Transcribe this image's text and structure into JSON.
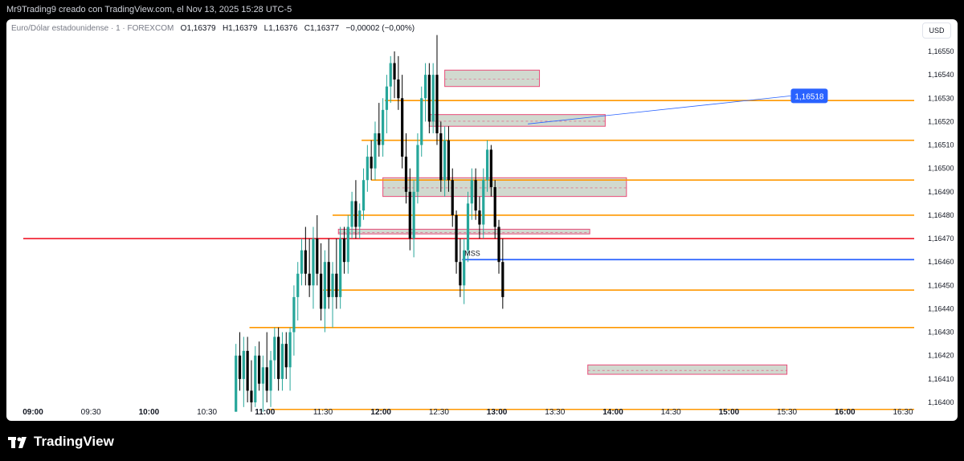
{
  "caption": "Mr9Trading9 creado con TradingView.com, el Nov 13, 2025 15:28 UTC-5",
  "header": {
    "symbol": "Euro/Dólar estadounidense · 1 · FOREXCOM",
    "o_label": "O",
    "o_value": "1,16379",
    "h_label": "H",
    "h_value": "1,16379",
    "l_label": "L",
    "l_value": "1,16376",
    "c_label": "C",
    "c_value": "1,16377",
    "change": "−0,00002 (−0,00%)"
  },
  "currency": "USD",
  "brand": "TradingView",
  "colors": {
    "bull": "#26a69a",
    "bear": "#000000",
    "level_orange": "#ff9800",
    "level_red": "#f23645",
    "mss_blue": "#2962ff",
    "zone_fill": "#d1d9cf",
    "zone_border": "#e84d7a"
  },
  "chart_data": {
    "type": "candlestick",
    "title": "",
    "xlabel": "",
    "ylabel": "",
    "x_ticks": [
      "09:00",
      "09:30",
      "10:00",
      "10:30",
      "11:00",
      "11:30",
      "12:00",
      "12:30",
      "13:00",
      "13:30",
      "14:00",
      "14:30",
      "15:00",
      "15:30",
      "16:00",
      "16:30"
    ],
    "y_ticks": [
      "1,16550",
      "1,16540",
      "1,16530",
      "1,16520",
      "1,16510",
      "1,16500",
      "1,16490",
      "1,16480",
      "1,16470",
      "1,16460",
      "1,16450",
      "1,16440",
      "1,16430",
      "1,16420",
      "1,16410",
      "1,16400"
    ],
    "ylim": [
      1.16396,
      1.16556
    ],
    "grid": false,
    "series": [
      {
        "values": [
          [
            "10:45",
            1.16396,
            1.16425,
            1.16396,
            1.1642
          ],
          [
            "10:47",
            1.1642,
            1.1643,
            1.16405,
            1.1641
          ],
          [
            "10:49",
            1.1641,
            1.16428,
            1.16398,
            1.16422
          ],
          [
            "10:51",
            1.16422,
            1.16428,
            1.164,
            1.16405
          ],
          [
            "10:53",
            1.16405,
            1.16418,
            1.16396,
            1.164
          ],
          [
            "10:55",
            1.164,
            1.16424,
            1.16398,
            1.1642
          ],
          [
            "10:57",
            1.1642,
            1.16426,
            1.16405,
            1.16408
          ],
          [
            "10:59",
            1.16408,
            1.1642,
            1.16396,
            1.16415
          ],
          [
            "11:01",
            1.16415,
            1.1643,
            1.164,
            1.16405
          ],
          [
            "11:03",
            1.16405,
            1.16422,
            1.16398,
            1.16418
          ],
          [
            "11:05",
            1.16418,
            1.16432,
            1.1641,
            1.16428
          ],
          [
            "11:07",
            1.16428,
            1.16432,
            1.16405,
            1.1641
          ],
          [
            "11:09",
            1.1641,
            1.1643,
            1.16405,
            1.16425
          ],
          [
            "11:11",
            1.16425,
            1.1643,
            1.1641,
            1.16415
          ],
          [
            "11:13",
            1.16415,
            1.16432,
            1.16405,
            1.1643
          ],
          [
            "11:15",
            1.1643,
            1.1645,
            1.1642,
            1.16445
          ],
          [
            "11:17",
            1.16445,
            1.1646,
            1.16435,
            1.16455
          ],
          [
            "11:19",
            1.16455,
            1.1647,
            1.1645,
            1.16465
          ],
          [
            "11:21",
            1.16465,
            1.16475,
            1.1645,
            1.16455
          ],
          [
            "11:23",
            1.16455,
            1.1647,
            1.16445,
            1.1645
          ],
          [
            "11:25",
            1.1645,
            1.16475,
            1.1644,
            1.1647
          ],
          [
            "11:27",
            1.1647,
            1.1648,
            1.1645,
            1.16455
          ],
          [
            "11:29",
            1.16455,
            1.16468,
            1.16435,
            1.1644
          ],
          [
            "11:31",
            1.1644,
            1.16465,
            1.1643,
            1.1646
          ],
          [
            "11:33",
            1.1646,
            1.1647,
            1.1644,
            1.16445
          ],
          [
            "11:35",
            1.16445,
            1.1646,
            1.16432,
            1.16455
          ],
          [
            "11:37",
            1.16455,
            1.1647,
            1.1644,
            1.16445
          ],
          [
            "11:39",
            1.16445,
            1.16475,
            1.1644,
            1.1647
          ],
          [
            "11:41",
            1.1647,
            1.16475,
            1.16455,
            1.1646
          ],
          [
            "11:43",
            1.1646,
            1.1648,
            1.16455,
            1.16475
          ],
          [
            "11:45",
            1.16475,
            1.1649,
            1.1647,
            1.16486
          ],
          [
            "11:47",
            1.16486,
            1.16495,
            1.1647,
            1.16475
          ],
          [
            "11:49",
            1.16475,
            1.16485,
            1.1647,
            1.16482
          ],
          [
            "11:51",
            1.16482,
            1.165,
            1.16478,
            1.16495
          ],
          [
            "11:53",
            1.16495,
            1.1651,
            1.1649,
            1.16505
          ],
          [
            "11:55",
            1.16505,
            1.16512,
            1.16495,
            1.165
          ],
          [
            "11:57",
            1.165,
            1.1652,
            1.16495,
            1.16515
          ],
          [
            "11:59",
            1.16515,
            1.16528,
            1.16505,
            1.1651
          ],
          [
            "12:01",
            1.1651,
            1.1653,
            1.16505,
            1.16525
          ],
          [
            "12:03",
            1.16525,
            1.1654,
            1.16515,
            1.16535
          ],
          [
            "12:05",
            1.16535,
            1.16548,
            1.16528,
            1.16545
          ],
          [
            "12:07",
            1.16545,
            1.1655,
            1.1653,
            1.16538
          ],
          [
            "12:09",
            1.16538,
            1.16548,
            1.16525,
            1.1653
          ],
          [
            "12:11",
            1.1653,
            1.1654,
            1.165,
            1.16505
          ],
          [
            "12:13",
            1.16505,
            1.16515,
            1.16485,
            1.1649
          ],
          [
            "12:15",
            1.1649,
            1.165,
            1.16465,
            1.1647
          ],
          [
            "12:17",
            1.1647,
            1.16495,
            1.16462,
            1.1649
          ],
          [
            "12:19",
            1.1649,
            1.16515,
            1.16485,
            1.1651
          ],
          [
            "12:21",
            1.1651,
            1.16535,
            1.16505,
            1.1653
          ],
          [
            "12:23",
            1.1653,
            1.16545,
            1.1652,
            1.1654
          ],
          [
            "12:25",
            1.1654,
            1.16545,
            1.16515,
            1.1652
          ],
          [
            "12:27",
            1.1652,
            1.16545,
            1.16515,
            1.1654
          ],
          [
            "12:29",
            1.1654,
            1.16557,
            1.1651,
            1.16515
          ],
          [
            "12:31",
            1.16515,
            1.1652,
            1.1649,
            1.16495
          ],
          [
            "12:33",
            1.16495,
            1.16518,
            1.16488,
            1.16512
          ],
          [
            "12:35",
            1.16512,
            1.16518,
            1.1649,
            1.16495
          ],
          [
            "12:37",
            1.16495,
            1.165,
            1.16475,
            1.1648
          ],
          [
            "12:39",
            1.1648,
            1.16482,
            1.16455,
            1.1646
          ],
          [
            "12:41",
            1.1646,
            1.1647,
            1.16445,
            1.1645
          ],
          [
            "12:43",
            1.1645,
            1.1647,
            1.16442,
            1.16465
          ],
          [
            "12:45",
            1.16465,
            1.1649,
            1.1646,
            1.16485
          ],
          [
            "12:47",
            1.16485,
            1.165,
            1.16478,
            1.16495
          ],
          [
            "12:49",
            1.16495,
            1.165,
            1.16478,
            1.16482
          ],
          [
            "12:51",
            1.16482,
            1.16488,
            1.1647,
            1.16476
          ],
          [
            "12:53",
            1.16476,
            1.165,
            1.1647,
            1.16495
          ],
          [
            "12:55",
            1.16495,
            1.16512,
            1.1649,
            1.16508
          ],
          [
            "12:57",
            1.16508,
            1.1651,
            1.16488,
            1.16492
          ],
          [
            "12:59",
            1.16492,
            1.16495,
            1.1647,
            1.16475
          ],
          [
            "13:01",
            1.16475,
            1.16478,
            1.16455,
            1.1646
          ],
          [
            "13:03",
            1.1646,
            1.1647,
            1.1644,
            1.16445
          ]
        ]
      }
    ],
    "levels": [
      {
        "price": 1.16529,
        "color": "orange",
        "from": "12:02"
      },
      {
        "price": 1.16512,
        "color": "orange",
        "from": "11:50"
      },
      {
        "price": 1.16495,
        "color": "orange",
        "from": "11:55"
      },
      {
        "price": 1.1648,
        "color": "orange",
        "from": "11:35"
      },
      {
        "price": 1.1647,
        "color": "red",
        "from": "08:55"
      },
      {
        "price": 1.16461,
        "color": "blue",
        "from": "12:42",
        "label": "MSS"
      },
      {
        "price": 1.16448,
        "color": "orange",
        "from": "11:30"
      },
      {
        "price": 1.16432,
        "color": "orange",
        "from": "10:52"
      },
      {
        "price": 1.16397,
        "color": "orange",
        "from": "11:02"
      }
    ],
    "zones": [
      {
        "from": "12:33",
        "to": "13:22",
        "low": 1.16535,
        "high": 1.16542
      },
      {
        "from": "12:25",
        "to": "13:56",
        "low": 1.16518,
        "high": 1.16523
      },
      {
        "from": "12:01",
        "to": "14:07",
        "low": 1.16488,
        "high": 1.16496
      },
      {
        "from": "11:38",
        "to": "13:48",
        "low": 1.16472,
        "high": 1.16474
      },
      {
        "from": "13:47",
        "to": "15:30",
        "low": 1.16412,
        "high": 1.16416
      }
    ],
    "annotations": [
      {
        "label": "MSS",
        "time": "12:42",
        "price": 1.16461
      },
      {
        "label": "1,16518",
        "time": "13:16",
        "price": 1.16519,
        "time2": "15:32",
        "price2": 1.16531
      }
    ]
  }
}
